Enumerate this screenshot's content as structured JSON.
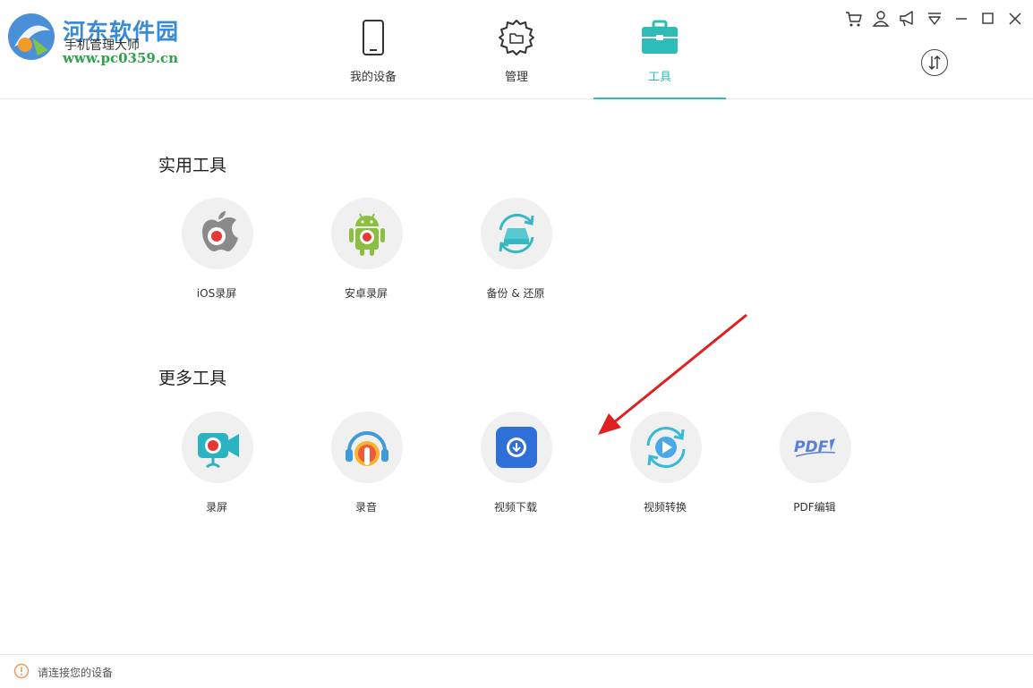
{
  "logo": {
    "title": "河东软件园",
    "app_name": "手机管理大师",
    "url": "www.pc0359.cn"
  },
  "nav": {
    "tabs": [
      {
        "label": "我的设备",
        "icon": "phone-icon"
      },
      {
        "label": "管理",
        "icon": "gear-folder-icon"
      },
      {
        "label": "工具",
        "icon": "toolbox-icon",
        "active": true
      }
    ]
  },
  "window_controls": [
    "cart-icon",
    "user-icon",
    "megaphone-icon",
    "dropdown-icon",
    "minimize-icon",
    "maximize-icon",
    "close-icon"
  ],
  "sections": {
    "utility": {
      "title": "实用工具",
      "tools": [
        {
          "label": "iOS录屏",
          "icon": "apple-record-icon"
        },
        {
          "label": "安卓录屏",
          "icon": "android-record-icon"
        },
        {
          "label": "备份 & 还原",
          "icon": "backup-restore-icon"
        }
      ]
    },
    "more": {
      "title": "更多工具",
      "tools": [
        {
          "label": "录屏",
          "icon": "video-camera-icon"
        },
        {
          "label": "录音",
          "icon": "headphone-mic-icon"
        },
        {
          "label": "视频下载",
          "icon": "video-download-icon"
        },
        {
          "label": "视频转换",
          "icon": "video-convert-icon"
        },
        {
          "label": "PDF编辑",
          "icon": "pdf-icon",
          "badge_text": "PDF"
        }
      ]
    }
  },
  "footer": {
    "status_text": "请连接您的设备"
  },
  "colors": {
    "accent": "#2ebcb6",
    "arrow": "#e02020"
  }
}
